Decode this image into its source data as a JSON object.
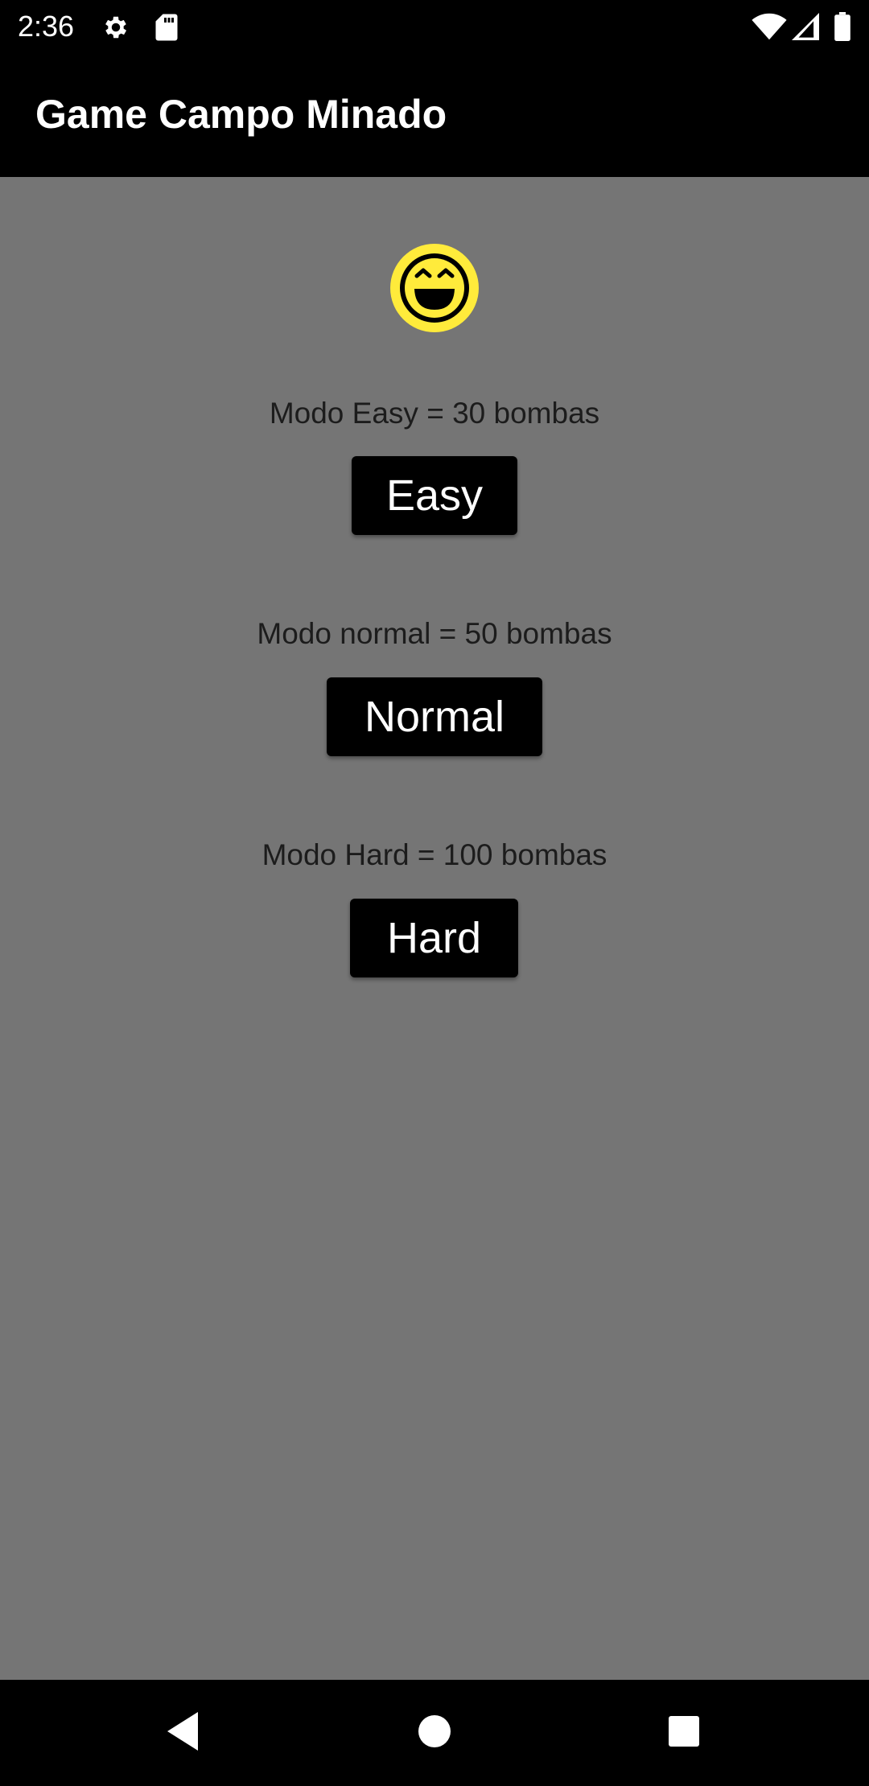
{
  "status_bar": {
    "time": "2:36",
    "left_icons": [
      "gear-icon",
      "sd-card-icon"
    ],
    "right_icons": [
      "wifi-icon",
      "signal-icon",
      "battery-icon"
    ]
  },
  "app_bar": {
    "title": "Game Campo Minado"
  },
  "main": {
    "face_icon": "grinning-face-icon",
    "face_color": "#FFEB3B",
    "modes": [
      {
        "description": "Modo Easy = 30 bombas",
        "button_label": "Easy"
      },
      {
        "description": "Modo normal = 50 bombas",
        "button_label": "Normal"
      },
      {
        "description": "Modo Hard = 100 bombas",
        "button_label": "Hard"
      }
    ]
  },
  "nav_bar": {
    "buttons": [
      "back-icon",
      "home-icon",
      "recents-icon"
    ]
  },
  "colors": {
    "background": "#757575",
    "bars": "#000000",
    "button_bg": "#000000",
    "button_text": "#FFFFFF",
    "label_text": "#1C1C1C"
  }
}
